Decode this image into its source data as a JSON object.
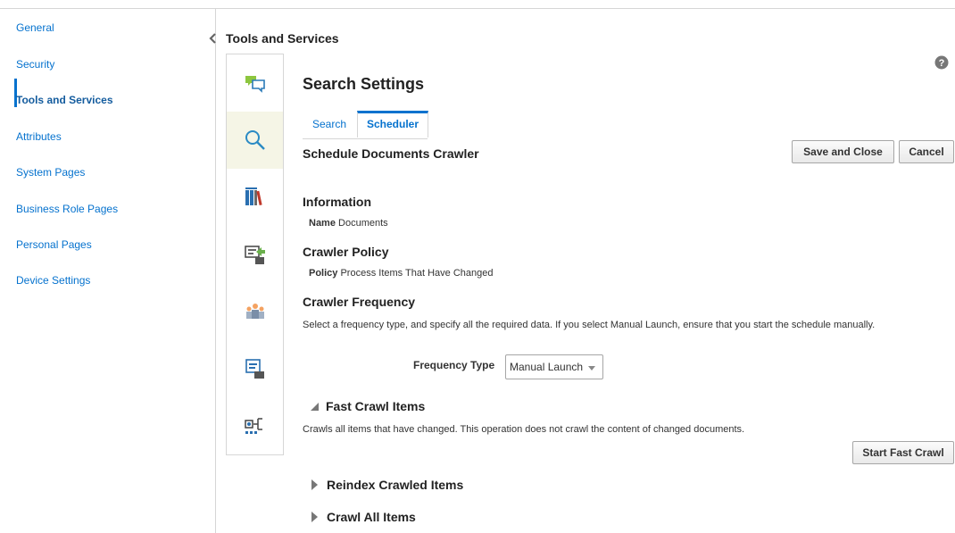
{
  "nav": {
    "items": [
      {
        "label": "General"
      },
      {
        "label": "Security"
      },
      {
        "label": "Tools and Services"
      },
      {
        "label": "Attributes"
      },
      {
        "label": "System Pages"
      },
      {
        "label": "Business Role Pages"
      },
      {
        "label": "Personal Pages"
      },
      {
        "label": "Device Settings"
      }
    ],
    "active_index": 2
  },
  "header": {
    "title": "Tools and Services",
    "help_icon": "help-icon"
  },
  "rail": {
    "icons": [
      "chat-icon",
      "search-icon",
      "library-icon",
      "export-icon",
      "people-icon",
      "document-settings-icon",
      "flow-icon"
    ],
    "selected_index": 1
  },
  "content": {
    "title": "Search Settings",
    "tabs": [
      {
        "label": "Search"
      },
      {
        "label": "Scheduler"
      }
    ],
    "active_tab": 1,
    "section_title": "Schedule Documents Crawler",
    "buttons": {
      "save_close": "Save and Close",
      "cancel": "Cancel"
    },
    "information": {
      "heading": "Information",
      "name_label": "Name",
      "name_value": "Documents"
    },
    "crawler_policy": {
      "heading": "Crawler Policy",
      "policy_label": "Policy",
      "policy_value": "Process Items That Have Changed"
    },
    "crawler_frequency": {
      "heading": "Crawler Frequency",
      "description": "Select a frequency type, and specify all the required data. If you select Manual Launch, ensure that you start the schedule manually.",
      "frequency_label": "Frequency Type",
      "frequency_value": "Manual Launch"
    },
    "fast_crawl": {
      "heading": "Fast Crawl Items",
      "expanded": true,
      "description": "Crawls all items that have changed. This operation does not crawl the content of changed documents.",
      "button": "Start Fast Crawl"
    },
    "reindex": {
      "heading": "Reindex Crawled Items",
      "expanded": false
    },
    "crawl_all": {
      "heading": "Crawl All Items",
      "expanded": false
    }
  },
  "colors": {
    "link": "#0572ce",
    "border": "#d6d6d6",
    "selected_rail": "#f5f5e6"
  }
}
